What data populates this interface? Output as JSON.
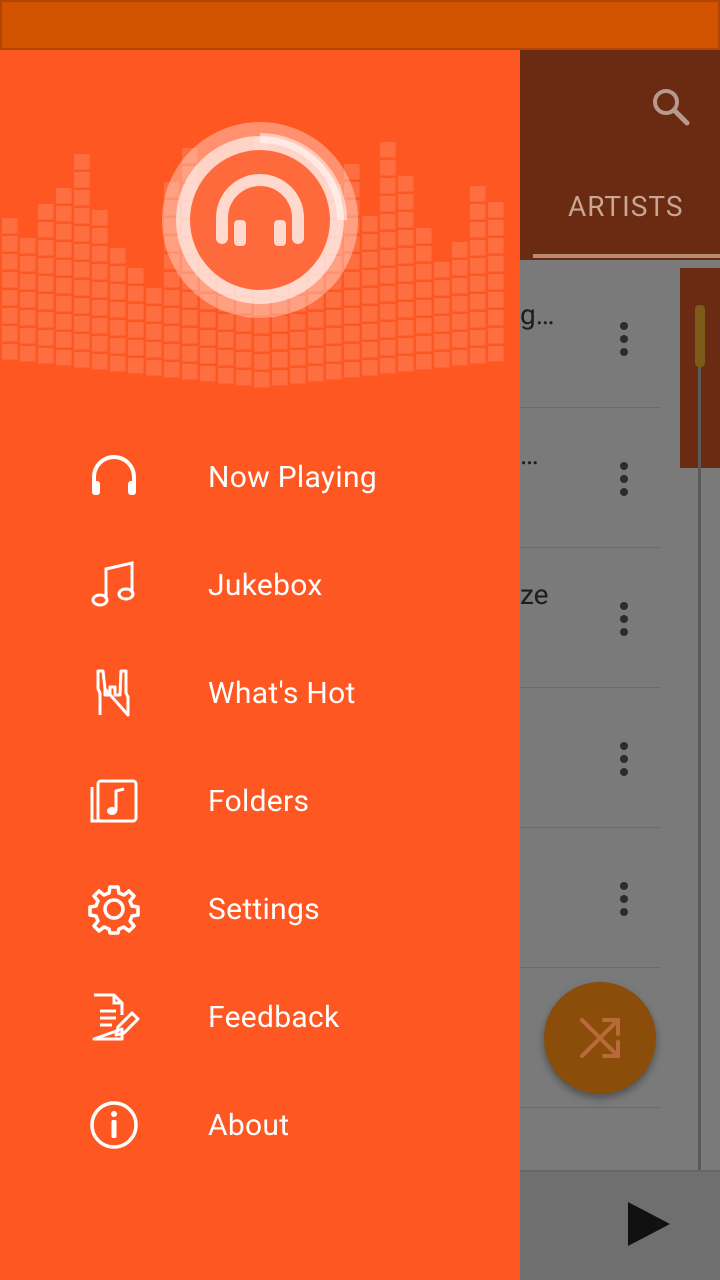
{
  "drawer": {
    "menu": [
      {
        "id": "now-playing",
        "label": "Now Playing",
        "icon": "headphones-icon"
      },
      {
        "id": "jukebox",
        "label": "Jukebox",
        "icon": "music-note-icon"
      },
      {
        "id": "whats-hot",
        "label": "What's Hot",
        "icon": "rock-hand-icon"
      },
      {
        "id": "folders",
        "label": "Folders",
        "icon": "music-folder-icon"
      },
      {
        "id": "settings",
        "label": "Settings",
        "icon": "gear-icon"
      },
      {
        "id": "feedback",
        "label": "Feedback",
        "icon": "document-edit-icon"
      },
      {
        "id": "about",
        "label": "About",
        "icon": "info-icon"
      }
    ]
  },
  "background": {
    "tab_label": "ARTISTS",
    "rows": [
      "g…",
      "…",
      "ze",
      "",
      "",
      "",
      ""
    ]
  },
  "colors": {
    "accent": "#ff5722",
    "status_bar": "#d35400"
  }
}
